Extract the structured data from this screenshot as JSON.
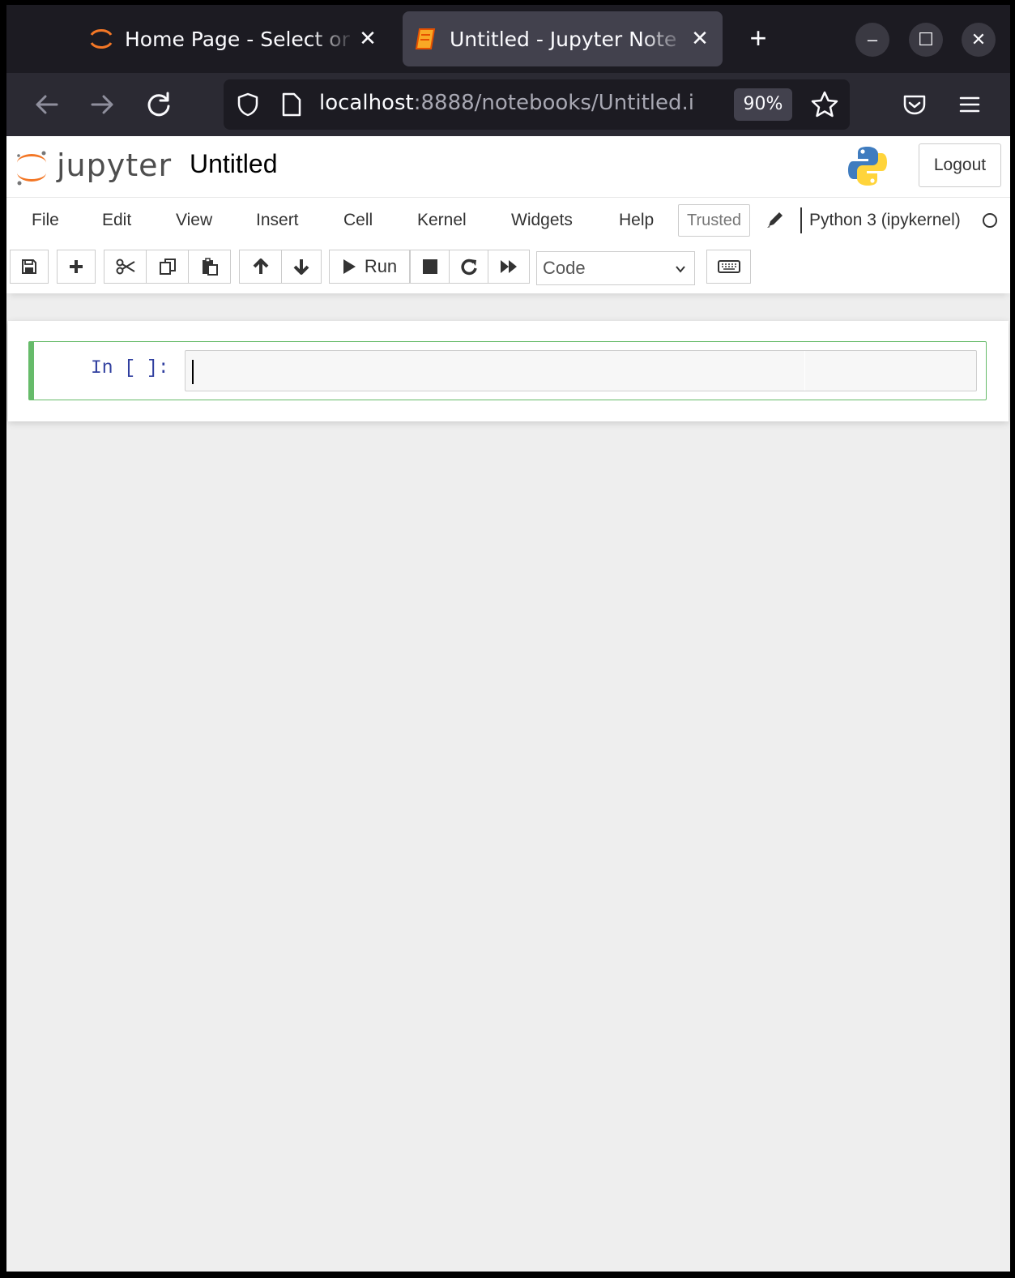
{
  "browser": {
    "tabs": [
      {
        "title": "Home Page - Select or c",
        "active": false,
        "close": "✕"
      },
      {
        "title": "Untitled - Jupyter Note",
        "active": true,
        "close": "✕"
      }
    ],
    "new_tab": "+",
    "window_controls": {
      "minimize": "–",
      "maximize": "☐",
      "close": "✕"
    },
    "url": {
      "host": "localhost",
      "rest": ":8888/notebooks/Untitled.i"
    },
    "zoom": "90%",
    "colors": {
      "tab_bg": "#1c1b22",
      "active_tab": "#42414d",
      "nav_bg": "#2b2a33"
    }
  },
  "jupyter": {
    "logo_text": "jupyter",
    "notebook_title": "Untitled",
    "logout_label": "Logout",
    "menu": [
      "File",
      "Edit",
      "View",
      "Insert",
      "Cell",
      "Kernel",
      "Widgets",
      "Help"
    ],
    "trusted_label": "Trusted",
    "kernel_name": "Python 3 (ipykernel)",
    "toolbar": {
      "run_label": "Run",
      "cell_type": "Code"
    },
    "cell": {
      "prompt": "In [ ]:",
      "content": ""
    },
    "colors": {
      "logo_orange": "#f37726",
      "cell_border": "#66bb6a",
      "prompt": "#303f9f"
    },
    "icons": [
      "save-icon",
      "plus-icon",
      "scissors-icon",
      "copy-icon",
      "paste-icon",
      "arrow-up-icon",
      "arrow-down-icon",
      "play-icon",
      "stop-icon",
      "restart-icon",
      "fast-forward-icon",
      "keyboard-icon",
      "pencil-icon",
      "kernel-idle-icon",
      "python-logo"
    ]
  }
}
